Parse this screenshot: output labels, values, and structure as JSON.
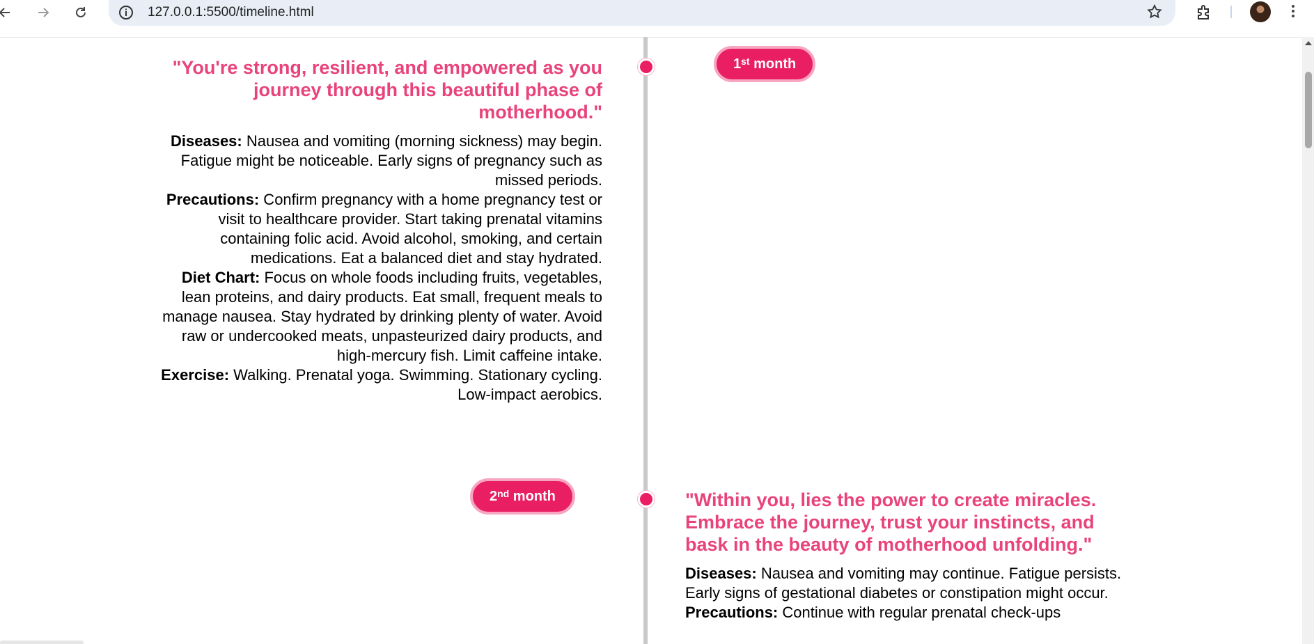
{
  "browser": {
    "url": "127.0.0.1:5500/timeline.html"
  },
  "months": [
    {
      "ordinal_number": "1",
      "ordinal_suffix": "st",
      "month_word": "month",
      "quote": "\"You're strong, resilient, and empowered as you journey through this beautiful phase of motherhood.\"",
      "diseases_label": "Diseases:",
      "diseases_text": " Nausea and vomiting (morning sickness) may begin. Fatigue might be noticeable. Early signs of pregnancy such as missed periods.",
      "precautions_label": "Precautions:",
      "precautions_text": " Confirm pregnancy with a home pregnancy test or visit to healthcare provider. Start taking prenatal vitamins containing folic acid. Avoid alcohol, smoking, and certain medications. Eat a balanced diet and stay hydrated.",
      "diet_label": "Diet Chart:",
      "diet_text": " Focus on whole foods including fruits, vegetables, lean proteins, and dairy products. Eat small, frequent meals to manage nausea. Stay hydrated by drinking plenty of water. Avoid raw or undercooked meats, unpasteurized dairy products, and high-mercury fish. Limit caffeine intake.",
      "exercise_label": "Exercise:",
      "exercise_text": " Walking. Prenatal yoga. Swimming. Stationary cycling. Low-impact aerobics."
    },
    {
      "ordinal_number": "2",
      "ordinal_suffix": "nd",
      "month_word": "month",
      "quote": "\"Within you, lies the power to create miracles. Embrace the journey, trust your instincts, and bask in the beauty of motherhood unfolding.\"",
      "diseases_label": "Diseases:",
      "diseases_text": " Nausea and vomiting may continue. Fatigue persists. Early signs of gestational diabetes or constipation might occur.",
      "precautions_label": "Precautions:",
      "precautions_text": " Continue with regular prenatal check-ups"
    }
  ],
  "colors": {
    "accent": "#e91e63",
    "quote": "#e8437a",
    "line": "#c9c9c9"
  }
}
